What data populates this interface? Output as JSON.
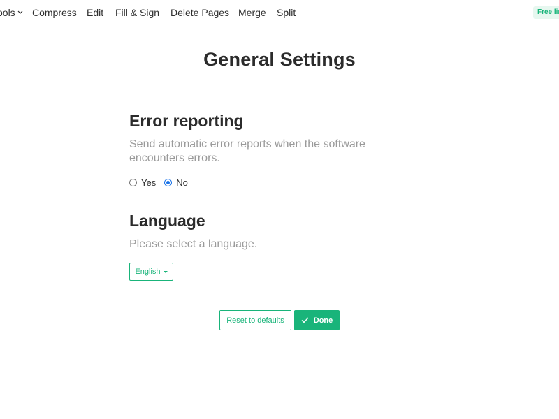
{
  "nav": {
    "tools": "ools",
    "compress": "Compress",
    "edit": "Edit",
    "fill_sign": "Fill & Sign",
    "delete_pages": "Delete Pages",
    "merge": "Merge",
    "split": "Split",
    "free_badge": "Free lim"
  },
  "page_title": "General Settings",
  "error_reporting": {
    "heading": "Error reporting",
    "description": "Send automatic error reports when the software encounters errors.",
    "options": [
      {
        "label": "Yes",
        "checked": false
      },
      {
        "label": "No",
        "checked": true
      }
    ]
  },
  "language": {
    "heading": "Language",
    "description": "Please select a language.",
    "selected": "English"
  },
  "buttons": {
    "reset": "Reset to defaults",
    "done": "Done"
  },
  "colors": {
    "accent": "#19b47a",
    "radio_selected": "#1a73e8"
  },
  "icons": {
    "tools_chevron": "chevron-down-icon",
    "done_check": "check-icon",
    "language_caret": "caret-down-icon"
  }
}
